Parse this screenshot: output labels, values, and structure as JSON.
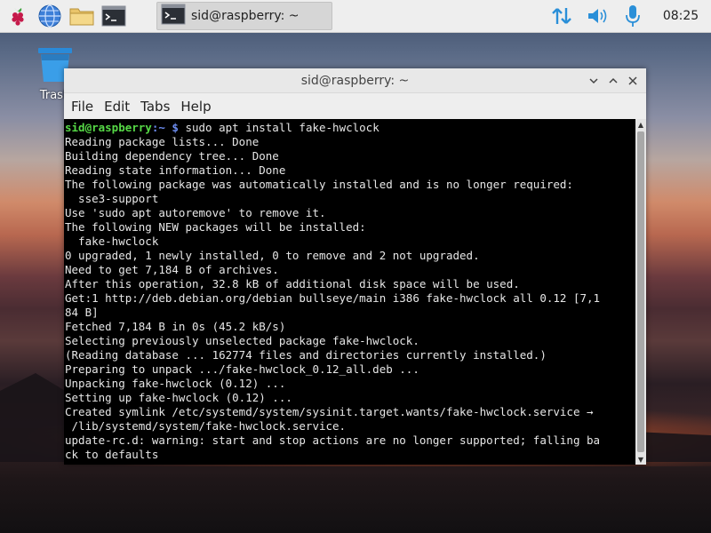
{
  "desktop": {
    "trash_label": "Trash"
  },
  "taskbar": {
    "active_task_label": "sid@raspberry: ~",
    "clock": "08:25",
    "icons": [
      "raspberry-menu-icon",
      "web-browser-icon",
      "file-manager-icon",
      "terminal-icon"
    ],
    "tray_icons": [
      "network-icon",
      "volume-icon",
      "microphone-icon"
    ]
  },
  "window": {
    "title": "sid@raspberry: ~",
    "menu": [
      "File",
      "Edit",
      "Tabs",
      "Help"
    ]
  },
  "terminal": {
    "prompt_user": "sid@raspberry",
    "prompt_path": ":~ $",
    "command": " sudo apt install fake-hwclock",
    "lines": [
      "Reading package lists... Done",
      "Building dependency tree... Done",
      "Reading state information... Done",
      "The following package was automatically installed and is no longer required:",
      "  sse3-support",
      "Use 'sudo apt autoremove' to remove it.",
      "The following NEW packages will be installed:",
      "  fake-hwclock",
      "0 upgraded, 1 newly installed, 0 to remove and 2 not upgraded.",
      "Need to get 7,184 B of archives.",
      "After this operation, 32.8 kB of additional disk space will be used.",
      "Get:1 http://deb.debian.org/debian bullseye/main i386 fake-hwclock all 0.12 [7,1",
      "84 B]",
      "Fetched 7,184 B in 0s (45.2 kB/s)",
      "Selecting previously unselected package fake-hwclock.",
      "(Reading database ... 162774 files and directories currently installed.)",
      "Preparing to unpack .../fake-hwclock_0.12_all.deb ...",
      "Unpacking fake-hwclock (0.12) ...",
      "Setting up fake-hwclock (0.12) ...",
      "Created symlink /etc/systemd/system/sysinit.target.wants/fake-hwclock.service →",
      " /lib/systemd/system/fake-hwclock.service.",
      "update-rc.d: warning: start and stop actions are no longer supported; falling ba",
      "ck to defaults"
    ]
  },
  "colors": {
    "prompt_user": "#56d946",
    "prompt_path": "#6c8cf0",
    "terminal_bg": "#000000",
    "terminal_fg": "#e6e6e6",
    "tray_accent": "#2a8fd8"
  }
}
